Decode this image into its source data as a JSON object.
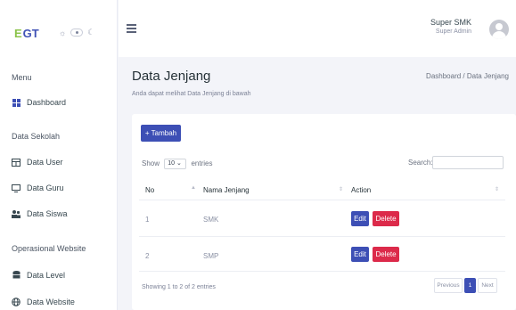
{
  "brand": {
    "logo_prefix": "E",
    "logo_text": "GT"
  },
  "sidebar": {
    "menu_heading": "Menu",
    "dashboard": "Dashboard",
    "data_sekolah_heading": "Data Sekolah",
    "data_user": "Data User",
    "data_guru": "Data Guru",
    "data_siswa": "Data Siswa",
    "operasional_heading": "Operasional Website",
    "data_level": "Data Level",
    "data_website": "Data Website"
  },
  "header": {
    "user_name": "Super SMK",
    "user_role": "Super Admin"
  },
  "page": {
    "title": "Data Jenjang",
    "subtitle": "Anda dapat melihat Data Jenjang di bawah",
    "breadcrumb": "Dashboard / Data Jenjang"
  },
  "toolbar": {
    "add_label": "+ Tambah",
    "show_label": "Show",
    "entries_value": "10",
    "entries_label": "entries",
    "search_label": "Search:",
    "search_value": ""
  },
  "table": {
    "headers": [
      "No",
      "Nama Jenjang",
      "Action"
    ],
    "rows": [
      {
        "no": "1",
        "nama": "SMK"
      },
      {
        "no": "2",
        "nama": "SMP"
      }
    ],
    "edit_label": "Edit",
    "delete_label": "Delete"
  },
  "footer": {
    "info": "Showing 1 to 2 of 2 entries",
    "prev": "Previous",
    "page": "1",
    "next": "Next"
  },
  "colors": {
    "primary": "#3d4fb5",
    "danger": "#dc2a4a",
    "background": "#f3f4f9"
  }
}
